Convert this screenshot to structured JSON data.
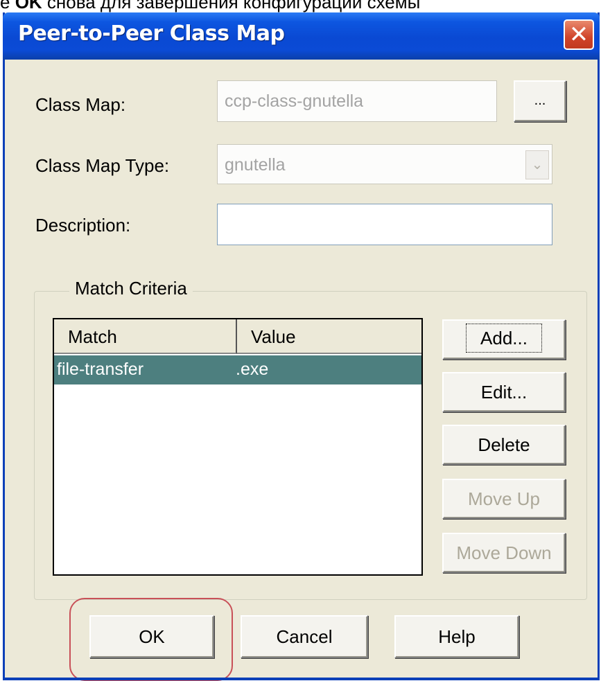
{
  "caption": {
    "prefix": "е ",
    "bold": "OK",
    "rest": " снова для завершения конфигурации схемы"
  },
  "dialog": {
    "title": "Peer-to-Peer Class Map",
    "close_glyph": "✕"
  },
  "form": {
    "class_map_label": "Class Map:",
    "class_map_value": "ccp-class-gnutella",
    "browse_label": "...",
    "class_map_type_label": "Class Map Type:",
    "class_map_type_value": "gnutella",
    "combo_arrow": "⌄",
    "description_label": "Description:",
    "description_value": ""
  },
  "match_criteria": {
    "legend": "Match Criteria",
    "columns": [
      "Match",
      "Value"
    ],
    "rows": [
      {
        "match": "file-transfer",
        "value": ".exe",
        "selected": true
      }
    ],
    "buttons": {
      "add": "Add...",
      "edit": "Edit...",
      "delete": "Delete",
      "move_up": "Move Up",
      "move_down": "Move Down"
    }
  },
  "footer": {
    "ok": "OK",
    "cancel": "Cancel",
    "help": "Help"
  },
  "colors": {
    "titlebar": "#0a49d3",
    "dialog_bg": "#ece9d8",
    "selected_row": "#4d7f7f",
    "highlight_ring": "#c85058",
    "close_button": "#d1442a"
  }
}
